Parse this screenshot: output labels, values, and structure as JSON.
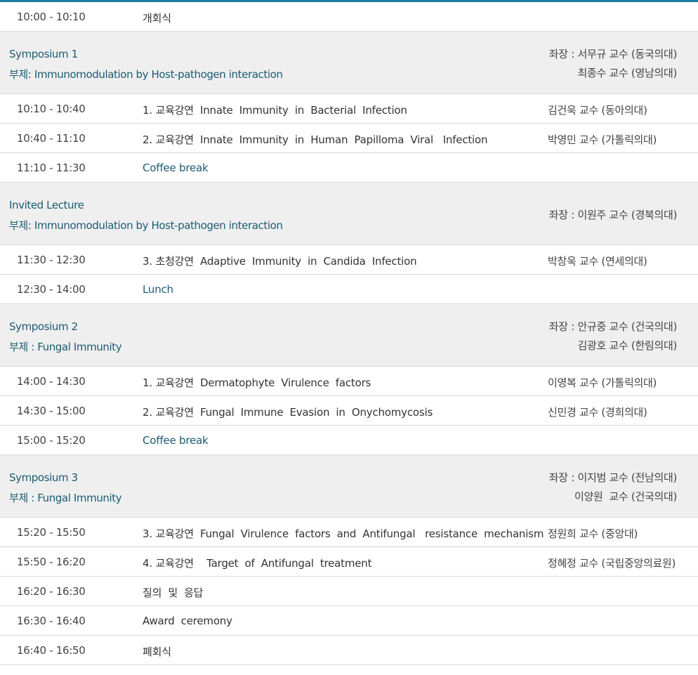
{
  "program": [
    {
      "kind": "item",
      "time": "10:00 - 10:10",
      "title": "개회식",
      "speaker": "",
      "accent": false
    },
    {
      "kind": "section",
      "line1": "Symposium 1",
      "line2": "부제: Immunomodulation by Host-pathogen interaction",
      "chairs": [
        "좌장 : 서무규 교수 (동국의대)",
        "최종수 교수 (영남의대)"
      ]
    },
    {
      "kind": "item",
      "time": "10:10 - 10:40",
      "title": "1. 교육강연  Innate  Immunity  in  Bacterial  Infection",
      "speaker": "김건욱 교수 (동아의대)",
      "accent": false
    },
    {
      "kind": "item",
      "time": "10:40 - 11:10",
      "title": "2. 교육강연  Innate  Immunity  in  Human  Papilloma  Viral   Infection",
      "speaker": "박영민 교수 (가톨릭의대)",
      "accent": false
    },
    {
      "kind": "item",
      "time": "11:10 - 11:30",
      "title": "Coffee break",
      "speaker": "",
      "accent": true
    },
    {
      "kind": "section",
      "line1": "Invited Lecture",
      "line2": "부제: Immunomodulation by Host-pathogen interaction",
      "chairs": [
        "좌장 : 이원주 교수 (경북의대)"
      ]
    },
    {
      "kind": "item",
      "time": "11:30 - 12:30",
      "title": "3. 초청강연  Adaptive  Immunity  in  Candida  Infection",
      "speaker": "박창욱 교수 (연세의대)",
      "accent": false
    },
    {
      "kind": "item",
      "time": "12:30 - 14:00",
      "title": "Lunch",
      "speaker": "",
      "accent": true
    },
    {
      "kind": "section",
      "line1": "Symposium 2",
      "line2": "부제 : Fungal Immunity",
      "chairs": [
        "좌장 : 안규중 교수 (건국의대)",
        "김광호 교수 (한림의대)"
      ]
    },
    {
      "kind": "item",
      "time": "14:00 - 14:30",
      "title": "1. 교육강연  Dermatophyte  Virulence  factors",
      "speaker": "이영복 교수 (가톨릭의대)",
      "accent": false
    },
    {
      "kind": "item",
      "time": "14:30 - 15:00",
      "title": "2. 교육강연  Fungal  Immune  Evasion  in  Onychomycosis",
      "speaker": "신민경 교수 (경희의대)",
      "accent": false
    },
    {
      "kind": "item",
      "time": "15:00 - 15:20",
      "title": "Coffee break",
      "speaker": "",
      "accent": true
    },
    {
      "kind": "section",
      "line1": "Symposium 3",
      "line2": "부제 : Fungal Immunity",
      "chairs": [
        "좌장 : 이지범 교수 (전남의대)",
        "이양원  교수 (건국의대)"
      ]
    },
    {
      "kind": "item",
      "time": "15:20 - 15:50",
      "title": "3. 교육강연  Fungal  Virulence  factors  and  Antifungal   resistance  mechanism",
      "speaker": "정원희 교수 (중앙대)",
      "accent": false
    },
    {
      "kind": "item",
      "time": "15:50 - 16:20",
      "title": "4. 교육강연    Target  of  Antifungal  treatment",
      "speaker": "정혜정 교수 (국립중앙의료원)",
      "accent": false
    },
    {
      "kind": "item",
      "time": "16:20 - 16:30",
      "title": "질의  및  응답",
      "speaker": "",
      "accent": false
    },
    {
      "kind": "item",
      "time": "16:30 - 16:40",
      "title": "Award  ceremony",
      "speaker": "",
      "accent": false
    },
    {
      "kind": "item",
      "time": "16:40 - 16:50",
      "title": "폐회식",
      "speaker": "",
      "accent": false
    }
  ]
}
